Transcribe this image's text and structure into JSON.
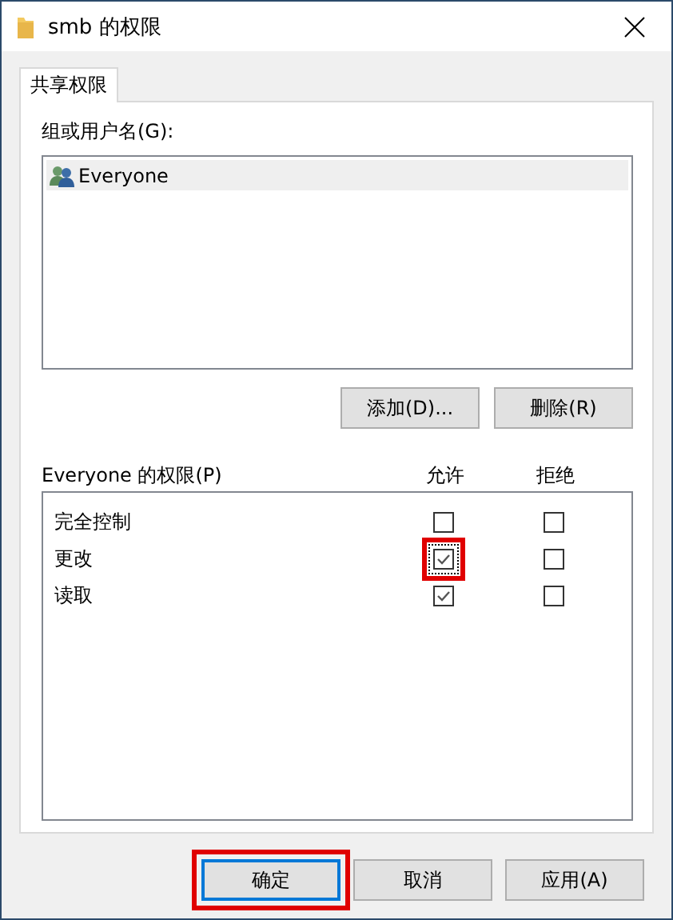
{
  "window": {
    "title": "smb 的权限"
  },
  "tabs": [
    {
      "label": "共享权限",
      "selected": true
    }
  ],
  "group_list": {
    "label": "组或用户名(G):",
    "items": [
      {
        "name": "Everyone",
        "selected": true
      }
    ]
  },
  "group_buttons": [
    "添加(D)...",
    "删除(R)"
  ],
  "permissions": {
    "label": "Everyone 的权限(P)",
    "columns": [
      "允许",
      "拒绝"
    ],
    "rows": [
      {
        "name": "完全控制",
        "allow": false,
        "deny": false,
        "focused": false,
        "highlighted": false
      },
      {
        "name": "更改",
        "allow": true,
        "deny": false,
        "focused": true,
        "highlighted": true
      },
      {
        "name": "读取",
        "allow": true,
        "deny": false,
        "focused": false,
        "highlighted": false
      }
    ]
  },
  "buttons": [
    {
      "label": "确定",
      "default": true,
      "highlighted": true
    },
    {
      "label": "取消",
      "default": false,
      "highlighted": false
    },
    {
      "label": "应用(A)",
      "default": false,
      "highlighted": false
    }
  ]
}
